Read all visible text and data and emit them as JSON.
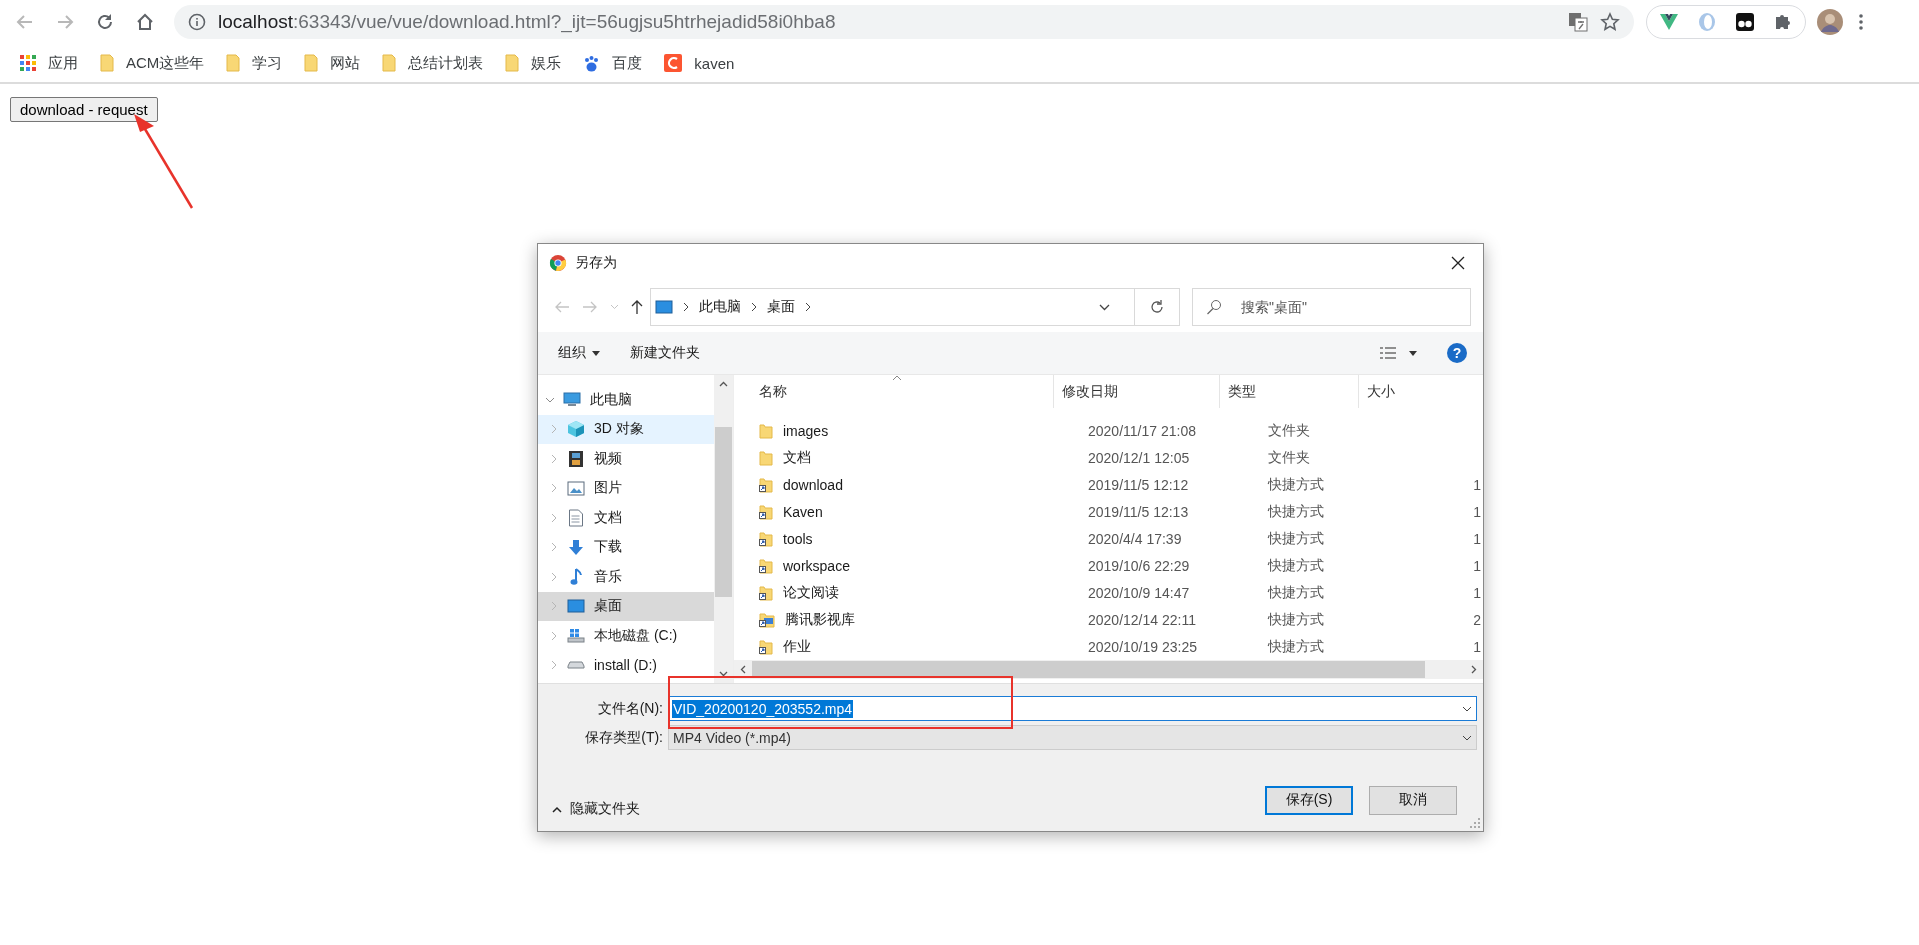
{
  "browser": {
    "url_host": "localhost",
    "url_path": ":63343/vue/vue/download.html?_ijt=56ugjsu5htrhejadid58i0hba8",
    "bookmarks": [
      {
        "kind": "apps",
        "label": "应用"
      },
      {
        "kind": "folder",
        "label": "ACM这些年"
      },
      {
        "kind": "folder",
        "label": "学习"
      },
      {
        "kind": "folder",
        "label": "网站"
      },
      {
        "kind": "folder",
        "label": "总结计划表"
      },
      {
        "kind": "folder",
        "label": "娱乐"
      },
      {
        "kind": "paw",
        "label": "百度"
      },
      {
        "kind": "letter",
        "label": "kaven"
      }
    ]
  },
  "page": {
    "button": "download - request"
  },
  "dialog": {
    "title": "另存为",
    "breadcrumb": [
      "此电脑",
      "桌面"
    ],
    "search": {
      "placeholder": "搜索\"桌面\""
    },
    "toolbar": {
      "organize": "组织",
      "new_folder": "新建文件夹",
      "help": "?"
    },
    "sidebar": {
      "items": [
        {
          "label": "此电脑",
          "kind": "computer",
          "expanded": true,
          "selected": false,
          "hovered": false,
          "children": [
            {
              "label": "3D 对象",
              "kind": "cube",
              "expanded": false,
              "selected": false,
              "hovered": true
            },
            {
              "label": "视频",
              "kind": "film",
              "expanded": false,
              "selected": false,
              "hovered": false
            },
            {
              "label": "图片",
              "kind": "image",
              "expanded": false,
              "selected": false,
              "hovered": false
            },
            {
              "label": "文档",
              "kind": "document",
              "expanded": false,
              "selected": false,
              "hovered": false
            },
            {
              "label": "下载",
              "kind": "download",
              "expanded": false,
              "selected": false,
              "hovered": false
            },
            {
              "label": "音乐",
              "kind": "music",
              "expanded": false,
              "selected": false,
              "hovered": false
            },
            {
              "label": "桌面",
              "kind": "desktop",
              "expanded": false,
              "selected": true,
              "hovered": false
            },
            {
              "label": "本地磁盘 (C:)",
              "kind": "system-drive",
              "expanded": false,
              "selected": false,
              "hovered": false
            },
            {
              "label": "install (D:)",
              "kind": "drive",
              "expanded": false,
              "selected": false,
              "hovered": false
            }
          ]
        }
      ]
    },
    "table": {
      "columns": [
        "名称",
        "修改日期",
        "类型",
        "大小"
      ],
      "rows": [
        {
          "kind": "folder",
          "name": "images",
          "date": "2020/11/17 21:08",
          "type": "文件夹"
        },
        {
          "kind": "folder",
          "name": "文档",
          "date": "2020/12/1 12:05",
          "type": "文件夹"
        },
        {
          "kind": "shortcut",
          "name": "download",
          "date": "2019/11/5 12:12",
          "type": "快捷方式",
          "size": "1"
        },
        {
          "kind": "shortcut",
          "name": "Kaven",
          "date": "2019/11/5 12:13",
          "type": "快捷方式",
          "size": "1"
        },
        {
          "kind": "shortcut",
          "name": "tools",
          "date": "2020/4/4 17:39",
          "type": "快捷方式",
          "size": "1"
        },
        {
          "kind": "shortcut",
          "name": "workspace",
          "date": "2019/10/6 22:29",
          "type": "快捷方式",
          "size": "1"
        },
        {
          "kind": "shortcut",
          "name": "论文阅读",
          "date": "2020/10/9 14:47",
          "type": "快捷方式",
          "size": "1"
        },
        {
          "kind": "media-shortcut",
          "name": "腾讯影视库",
          "date": "2020/12/14 22:11",
          "type": "快捷方式",
          "size": "2"
        },
        {
          "kind": "shortcut",
          "name": "作业",
          "date": "2020/10/19 23:25",
          "type": "快捷方式",
          "size": "1"
        }
      ]
    },
    "filename": {
      "label": "文件名(N):",
      "value": "VID_20200120_203552.mp4",
      "selected": true
    },
    "filetype": {
      "label": "保存类型(T):",
      "value": "MP4 Video (*.mp4)"
    },
    "hide_folders": "隐藏文件夹",
    "buttons": [
      {
        "label": "保存(S)",
        "default": true
      },
      {
        "label": "取消",
        "default": false
      }
    ]
  }
}
